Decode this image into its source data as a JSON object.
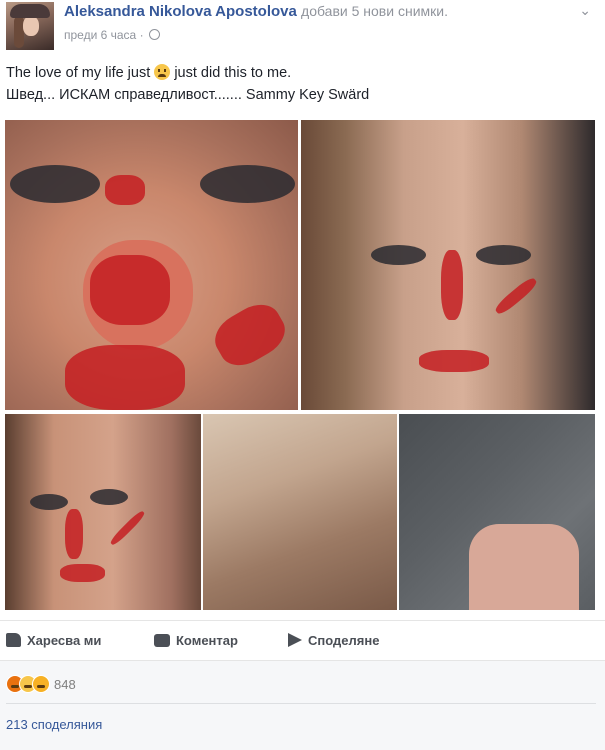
{
  "post": {
    "author": "Aleksandra Nikolova Apostolova",
    "action": "добави 5 нови снимки.",
    "time": "преди 6 часа",
    "separator": "·",
    "text_line1_a": "The love of my life just",
    "text_line1_b": "just did this to me.",
    "text_line2": "Швед... ИСКАМ справедливост....... Sammy Key Swärd",
    "menu_glyph": "⌄"
  },
  "actions": {
    "like_label": "Харесва ми",
    "comment_label": "Коментар",
    "share_label": "Споделяне"
  },
  "stats": {
    "reactions_count": "848",
    "shares_label": "213 споделяния"
  },
  "icons": {
    "privacy": "globe-icon",
    "emoji": "crying-face-emoji",
    "like": "thumbs-up-icon",
    "comment": "speech-bubble-icon",
    "share": "share-arrow-icon",
    "reactions": [
      "angry-reaction-icon",
      "sad-reaction-icon",
      "wow-reaction-icon"
    ]
  },
  "colors": {
    "link": "#365899",
    "muted": "#90949c",
    "action_text": "#4b4f56",
    "footer_bg": "#f6f7f9",
    "blood": "#c41e22"
  }
}
